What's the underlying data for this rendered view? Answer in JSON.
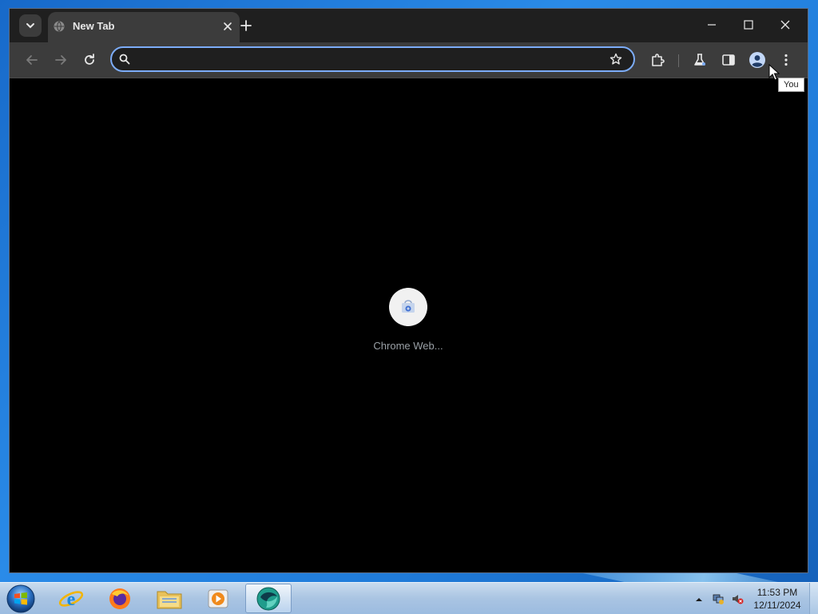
{
  "browser": {
    "tab": {
      "title": "New Tab"
    },
    "omnibox": {
      "value": "",
      "placeholder": ""
    },
    "tooltip": "You",
    "shortcuts": [
      {
        "label": "Chrome Web..."
      }
    ]
  },
  "taskbar": {
    "clock_time": "11:53 PM",
    "clock_date": "12/11/2024"
  },
  "colors": {
    "tab_strip": "#1f1f1f",
    "toolbar": "#3c3c3c",
    "omnibox_border": "#7cacf8",
    "page_background": "#000000"
  },
  "icons": {
    "tab_search": "chevron-down-icon",
    "tab_favicon": "globe-icon",
    "tab_close": "close-icon",
    "new_tab": "plus-icon",
    "back": "arrow-left-icon",
    "forward": "arrow-right-icon",
    "reload": "reload-icon",
    "omnibox_search": "search-icon",
    "bookmark": "star-icon",
    "extensions": "puzzle-icon",
    "labs": "flask-icon",
    "side_panel": "side-panel-icon",
    "profile": "profile-icon",
    "menu": "kebab-menu-icon"
  }
}
